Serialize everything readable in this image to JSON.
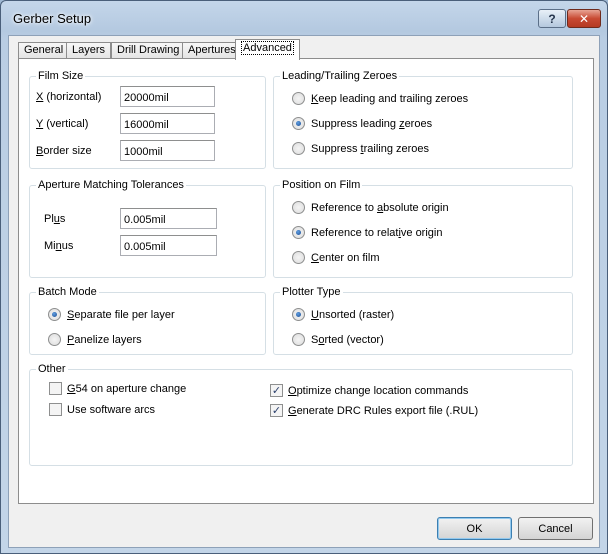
{
  "window": {
    "title": "Gerber Setup",
    "help_label": "?",
    "close_label": "✕"
  },
  "tabs": [
    {
      "label": "General",
      "active": false
    },
    {
      "label": "Layers",
      "active": false
    },
    {
      "label": "Drill Drawing",
      "active": false
    },
    {
      "label": "Apertures",
      "active": false
    },
    {
      "label": "Advanced",
      "active": true
    }
  ],
  "film_size": {
    "title": "Film Size",
    "x": {
      "key": "X",
      "rest": " (horizontal)",
      "value": "20000mil"
    },
    "y": {
      "key": "Y",
      "rest": " (vertical)",
      "value": "16000mil"
    },
    "border": {
      "key": "B",
      "rest": "order size",
      "value": "1000mil"
    }
  },
  "leading_trailing": {
    "title": "Leading/Trailing Zeroes",
    "options": [
      {
        "pre": "",
        "key": "K",
        "post": "eep leading and trailing zeroes",
        "selected": false
      },
      {
        "pre": "Suppress leading ",
        "key": "z",
        "post": "eroes",
        "selected": true
      },
      {
        "pre": "Suppress ",
        "key": "t",
        "post": "railing zeroes",
        "selected": false
      }
    ]
  },
  "aperture_tolerances": {
    "title": "Aperture Matching Tolerances",
    "plus": {
      "pre": "Pl",
      "key": "u",
      "post": "s",
      "value": "0.005mil"
    },
    "minus": {
      "pre": "Mi",
      "key": "n",
      "post": "us",
      "value": "0.005mil"
    }
  },
  "position_on_film": {
    "title": "Position on Film",
    "options": [
      {
        "pre": "Reference to ",
        "key": "a",
        "post": "bsolute origin",
        "selected": false
      },
      {
        "pre": "Reference to relat",
        "key": "i",
        "post": "ve origin",
        "selected": true
      },
      {
        "pre": "",
        "key": "C",
        "post": "enter on film",
        "selected": false
      }
    ]
  },
  "batch_mode": {
    "title": "Batch Mode",
    "options": [
      {
        "pre": "",
        "key": "S",
        "post": "eparate file per layer",
        "selected": true
      },
      {
        "pre": "",
        "key": "P",
        "post": "anelize layers",
        "selected": false
      }
    ]
  },
  "plotter_type": {
    "title": "Plotter Type",
    "options": [
      {
        "pre": "",
        "key": "U",
        "post": "nsorted (raster)",
        "selected": true
      },
      {
        "pre": "S",
        "key": "o",
        "post": "rted (vector)",
        "selected": false
      }
    ]
  },
  "other": {
    "title": "Other",
    "g54": {
      "pre": "",
      "key": "G",
      "post": "54 on aperture change",
      "checked": false
    },
    "software_arcs": {
      "pre": "Use software arcs",
      "key": "",
      "post": "",
      "checked": false
    },
    "optimize": {
      "pre": "",
      "key": "O",
      "post": "ptimize change location commands",
      "checked": true
    },
    "drc": {
      "pre": "",
      "key": "G",
      "post": "enerate DRC Rules export file (.RUL)",
      "checked": true
    }
  },
  "footer": {
    "ok_label": "OK",
    "cancel_label": "Cancel"
  }
}
